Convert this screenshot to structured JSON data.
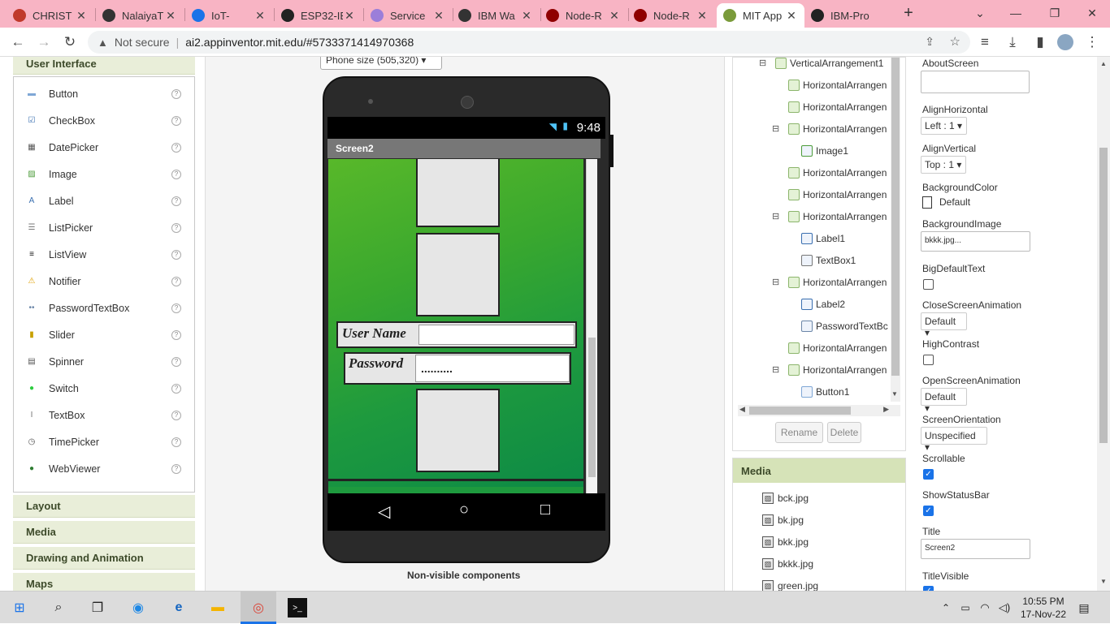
{
  "browser": {
    "tabs": [
      {
        "title": "CHRIST",
        "favicon": "christ-favicon",
        "color": "#c0392b"
      },
      {
        "title": "NalaiyaT",
        "favicon": "nalaiya-favicon",
        "color": "#333333"
      },
      {
        "title": "IoT-",
        "favicon": "vimeo-favicon",
        "color": "#1a73e8"
      },
      {
        "title": "ESP32-IE",
        "favicon": "wikipedia-favicon",
        "color": "#222222"
      },
      {
        "title": "Service",
        "favicon": "cloud-favicon",
        "color": "#9b7ed9"
      },
      {
        "title": "IBM Wa",
        "favicon": "ibm-favicon",
        "color": "#333333"
      },
      {
        "title": "Node-R",
        "favicon": "nodered-favicon",
        "color": "#8f0000"
      },
      {
        "title": "Node-R",
        "favicon": "nodered-favicon",
        "color": "#8f0000"
      },
      {
        "title": "MIT App",
        "favicon": "mit-favicon",
        "color": "#7a9b3a"
      },
      {
        "title": "IBM-Pro",
        "favicon": "github-favicon",
        "color": "#222222"
      }
    ],
    "url_security": "Not secure",
    "url": "ai2.appinventor.mit.edu/#5733371414970368"
  },
  "palette": {
    "section_title": "User Interface",
    "items": [
      {
        "label": "Button",
        "icon": "button-icon"
      },
      {
        "label": "CheckBox",
        "icon": "checkbox-icon"
      },
      {
        "label": "DatePicker",
        "icon": "datepicker-icon"
      },
      {
        "label": "Image",
        "icon": "image-icon"
      },
      {
        "label": "Label",
        "icon": "label-icon"
      },
      {
        "label": "ListPicker",
        "icon": "listpicker-icon"
      },
      {
        "label": "ListView",
        "icon": "listview-icon"
      },
      {
        "label": "Notifier",
        "icon": "notifier-icon"
      },
      {
        "label": "PasswordTextBox",
        "icon": "passwordtextbox-icon"
      },
      {
        "label": "Slider",
        "icon": "slider-icon"
      },
      {
        "label": "Spinner",
        "icon": "spinner-icon"
      },
      {
        "label": "Switch",
        "icon": "switch-icon"
      },
      {
        "label": "TextBox",
        "icon": "textbox-icon"
      },
      {
        "label": "TimePicker",
        "icon": "timepicker-icon"
      },
      {
        "label": "WebViewer",
        "icon": "webviewer-icon"
      }
    ],
    "help_glyph": "?",
    "categories": [
      "Layout",
      "Media",
      "Drawing and Animation",
      "Maps"
    ]
  },
  "viewer": {
    "phone_size": "Phone size (505,320)",
    "status_time": "9:48",
    "screen_title": "Screen2",
    "username_label": "User Name",
    "username_value": "",
    "password_label": "Password",
    "password_value": "..........",
    "nonvisible_label": "Non-visible components"
  },
  "tree": {
    "nodes": [
      {
        "label": "VerticalArrangement1",
        "depth": 1,
        "toggle": "⊟"
      },
      {
        "label": "HorizontalArrangen",
        "depth": 2,
        "toggle": ""
      },
      {
        "label": "HorizontalArrangen",
        "depth": 2,
        "toggle": ""
      },
      {
        "label": "HorizontalArrangen",
        "depth": 2,
        "toggle": "⊟"
      },
      {
        "label": "Image1",
        "depth": 3,
        "toggle": ""
      },
      {
        "label": "HorizontalArrangen",
        "depth": 2,
        "toggle": ""
      },
      {
        "label": "HorizontalArrangen",
        "depth": 2,
        "toggle": ""
      },
      {
        "label": "HorizontalArrangen",
        "depth": 2,
        "toggle": "⊟"
      },
      {
        "label": "Label1",
        "depth": 3,
        "toggle": ""
      },
      {
        "label": "TextBox1",
        "depth": 3,
        "toggle": ""
      },
      {
        "label": "HorizontalArrangen",
        "depth": 2,
        "toggle": "⊟"
      },
      {
        "label": "Label2",
        "depth": 3,
        "toggle": ""
      },
      {
        "label": "PasswordTextBc",
        "depth": 3,
        "toggle": ""
      },
      {
        "label": "HorizontalArrangen",
        "depth": 2,
        "toggle": ""
      },
      {
        "label": "HorizontalArrangen",
        "depth": 2,
        "toggle": "⊟"
      },
      {
        "label": "Button1",
        "depth": 3,
        "toggle": ""
      }
    ],
    "rename_label": "Rename",
    "delete_label": "Delete"
  },
  "media": {
    "title": "Media",
    "files": [
      "bck.jpg",
      "bk.jpg",
      "bkk.jpg",
      "bkkk.jpg",
      "green.jpg"
    ]
  },
  "properties": {
    "about_screen_label": "AboutScreen",
    "about_screen_value": "",
    "align_horizontal_label": "AlignHorizontal",
    "align_horizontal_value": "Left : 1 ▾",
    "align_vertical_label": "AlignVertical",
    "align_vertical_value": "Top : 1 ▾",
    "background_color_label": "BackgroundColor",
    "background_color_value": "Default",
    "background_image_label": "BackgroundImage",
    "background_image_value": "bkkk.jpg...",
    "big_default_text_label": "BigDefaultText",
    "big_default_text_checked": false,
    "close_screen_animation_label": "CloseScreenAnimation",
    "close_screen_animation_value": "Default ▾",
    "high_contrast_label": "HighContrast",
    "high_contrast_checked": false,
    "open_screen_animation_label": "OpenScreenAnimation",
    "open_screen_animation_value": "Default ▾",
    "screen_orientation_label": "ScreenOrientation",
    "screen_orientation_value": "Unspecified ▾",
    "scrollable_label": "Scrollable",
    "scrollable_checked": true,
    "show_status_bar_label": "ShowStatusBar",
    "show_status_bar_checked": true,
    "title_label": "Title",
    "title_value": "Screen2",
    "title_visible_label": "TitleVisible"
  },
  "taskbar": {
    "time": "10:55 PM",
    "date": "17-Nov-22"
  },
  "colors": {
    "tab_strip": "#f8b4c4",
    "category_header": "#e9eed9",
    "phone_body": "#2a2a2a",
    "screen_green": "#1f9a3a",
    "checkbox_blue": "#1a73e8"
  }
}
